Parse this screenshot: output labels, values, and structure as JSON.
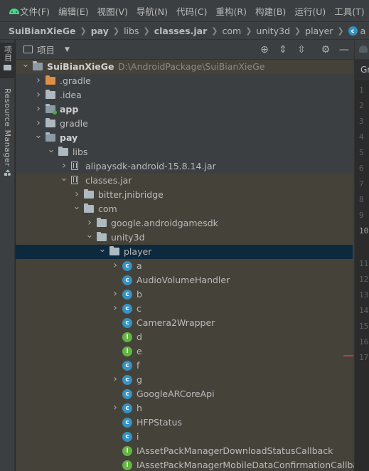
{
  "menu": {
    "items": [
      "文件(F)",
      "编辑(E)",
      "视图(V)",
      "导航(N)",
      "代码(C)",
      "重构(R)",
      "构建(B)",
      "运行(U)",
      "工具(T)"
    ]
  },
  "breadcrumb": {
    "items": [
      "SuiBianXieGe",
      "pay",
      "libs",
      "classes.jar",
      "com",
      "unity3d",
      "player",
      "a"
    ]
  },
  "left_strip": {
    "project_tab": "项目",
    "resource_tab": "Resource Manager"
  },
  "project_panel": {
    "title": "项目",
    "tree": [
      {
        "label": "SuiBianXieGe",
        "path": "D:\\AndroidPackage\\SuiBianXieGe",
        "icon": "module-folder-icon",
        "level": 0,
        "arrow": "down",
        "bold": true
      },
      {
        "label": ".gradle",
        "icon": "folder-icon",
        "level": 1,
        "arrow": "right"
      },
      {
        "label": ".idea",
        "icon": "folder-icon",
        "level": 1,
        "arrow": "right"
      },
      {
        "label": "app",
        "icon": "module-folder-icon",
        "level": 1,
        "arrow": "right",
        "bold": true
      },
      {
        "label": "gradle",
        "icon": "folder-icon",
        "level": 1,
        "arrow": "right"
      },
      {
        "label": "pay",
        "icon": "module-folder-icon",
        "level": 1,
        "arrow": "down",
        "bold": true
      },
      {
        "label": "libs",
        "icon": "folder-icon",
        "level": 2,
        "arrow": "down"
      },
      {
        "label": "alipaysdk-android-15.8.14.jar",
        "icon": "jar-icon",
        "level": 3,
        "arrow": "right"
      },
      {
        "label": "classes.jar",
        "icon": "jar-icon",
        "level": 3,
        "arrow": "down"
      },
      {
        "label": "bitter.jnibridge",
        "icon": "package-icon",
        "level": 4,
        "arrow": "right"
      },
      {
        "label": "com",
        "icon": "package-icon",
        "level": 4,
        "arrow": "down"
      },
      {
        "label": "google.androidgamesdk",
        "icon": "package-icon",
        "level": 5,
        "arrow": "right"
      },
      {
        "label": "unity3d",
        "icon": "package-icon",
        "level": 5,
        "arrow": "down"
      },
      {
        "label": "player",
        "icon": "package-icon",
        "level": 6,
        "arrow": "down"
      },
      {
        "label": "a",
        "icon": "class-icon",
        "level": 7,
        "arrow": "right"
      },
      {
        "label": "AudioVolumeHandler",
        "icon": "class-icon",
        "level": 7,
        "arrow": ""
      },
      {
        "label": "b",
        "icon": "class-icon",
        "level": 7,
        "arrow": "right"
      },
      {
        "label": "c",
        "icon": "class-icon",
        "level": 7,
        "arrow": "right"
      },
      {
        "label": "Camera2Wrapper",
        "icon": "class-icon",
        "level": 7,
        "arrow": ""
      },
      {
        "label": "d",
        "icon": "interface-icon",
        "level": 7,
        "arrow": ""
      },
      {
        "label": "e",
        "icon": "interface-icon",
        "level": 7,
        "arrow": ""
      },
      {
        "label": "f",
        "icon": "class-icon",
        "level": 7,
        "arrow": ""
      },
      {
        "label": "g",
        "icon": "class-icon",
        "level": 7,
        "arrow": "right"
      },
      {
        "label": "GoogleARCoreApi",
        "icon": "class-icon",
        "level": 7,
        "arrow": ""
      },
      {
        "label": "h",
        "icon": "class-icon",
        "level": 7,
        "arrow": "right"
      },
      {
        "label": "HFPStatus",
        "icon": "class-icon",
        "level": 7,
        "arrow": ""
      },
      {
        "label": "i",
        "icon": "class-icon",
        "level": 7,
        "arrow": ""
      },
      {
        "label": "IAssetPackManagerDownloadStatusCallback",
        "icon": "interface-icon",
        "level": 7,
        "arrow": ""
      },
      {
        "label": "IAssetPackManagerMobileDataConfirmationCallback",
        "icon": "interface-icon",
        "level": 7,
        "arrow": ""
      }
    ]
  },
  "editor": {
    "tab_label": "Gr",
    "line_numbers": [
      "1",
      "2",
      "3",
      "4",
      "5",
      "6",
      "7",
      "8",
      "9",
      "10",
      "11",
      "12",
      "13",
      "14",
      "15",
      "16",
      "17"
    ]
  },
  "colors": {
    "selection": "#0d293e",
    "class_icon": "#3592c4",
    "interface_icon": "#62b543",
    "excluded_folder": "#e08e46"
  }
}
